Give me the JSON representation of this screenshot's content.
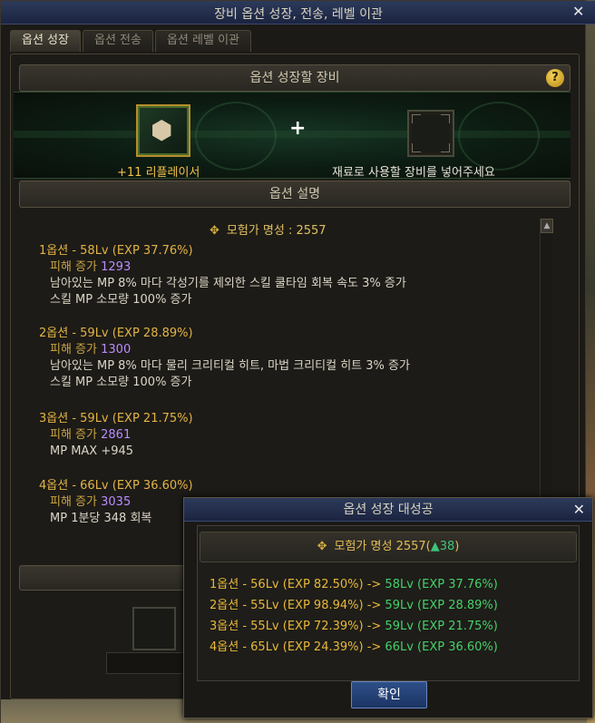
{
  "window": {
    "title": "장비 옵션 성장, 전송, 레벨 이관",
    "close_label": "✕"
  },
  "tabs": [
    {
      "label": "옵션 성장",
      "active": true
    },
    {
      "label": "옵션 전송",
      "active": false
    },
    {
      "label": "옵션 레벨 이관",
      "active": false
    }
  ],
  "equip_section": {
    "header": "옵션 성장할 장비",
    "help_label": "?",
    "plus_label": "+",
    "item_name": "+11 리플레이서",
    "material_hint": "재료로 사용할 장비를 넣어주세요"
  },
  "desc_section": {
    "header": "옵션 설명",
    "fame_text": "모험가 명성 : 2557",
    "options": [
      {
        "title": "1옵션 - 58Lv (EXP 37.76%)",
        "damage_label": "피해 증가",
        "damage_value": "1293",
        "lines": [
          "남아있는 MP 8% 마다 각성기를 제외한 스킬 쿨타임 회복 속도 3% 증가",
          "스킬 MP 소모량 100% 증가"
        ]
      },
      {
        "title": "2옵션 - 59Lv (EXP 28.89%)",
        "damage_label": "피해 증가",
        "damage_value": "1300",
        "lines": [
          "남아있는 MP 8% 마다 물리 크리티컬 히트, 마법 크리티컬 히트 3% 증가",
          "스킬 MP 소모량 100% 증가"
        ]
      },
      {
        "title": "3옵션 - 59Lv (EXP 21.75%)",
        "damage_label": "피해 증가",
        "damage_value": "2861",
        "lines": [
          "MP MAX +945"
        ]
      },
      {
        "title": "4옵션 - 66Lv (EXP 36.60%)",
        "damage_label": "피해 증가",
        "damage_value": "3035",
        "lines": [
          "MP 1분당 348 회복"
        ]
      }
    ]
  },
  "popup": {
    "title": "옵션 성장 대성공",
    "close_label": "✕",
    "fame_prefix": "모험가 명성 2557(",
    "fame_up": "▲38",
    "fame_suffix": ")",
    "rows": [
      {
        "pre": "1옵션 - 56Lv (EXP 82.50%)",
        "arrow": " -> ",
        "post": "58Lv (EXP 37.76%)"
      },
      {
        "pre": "2옵션 - 55Lv (EXP 98.94%)",
        "arrow": " -> ",
        "post": "59Lv (EXP 28.89%)"
      },
      {
        "pre": "3옵션 - 55Lv (EXP 72.39%)",
        "arrow": " -> ",
        "post": "59Lv (EXP 21.75%)"
      },
      {
        "pre": "4옵션 - 65Lv (EXP 24.39%)",
        "arrow": " -> ",
        "post": "66Lv (EXP 36.60%)"
      }
    ],
    "confirm_label": "확인"
  },
  "colors": {
    "title_gold": "#e2b445",
    "damage_value_purple": "#b98cff",
    "success_green": "#46d06a",
    "item_name_gold": "#f2c24a"
  },
  "icons": {
    "fame": "laurel-crest-icon",
    "item": "dice-cube-icon",
    "help": "question-icon",
    "close": "close-icon"
  }
}
